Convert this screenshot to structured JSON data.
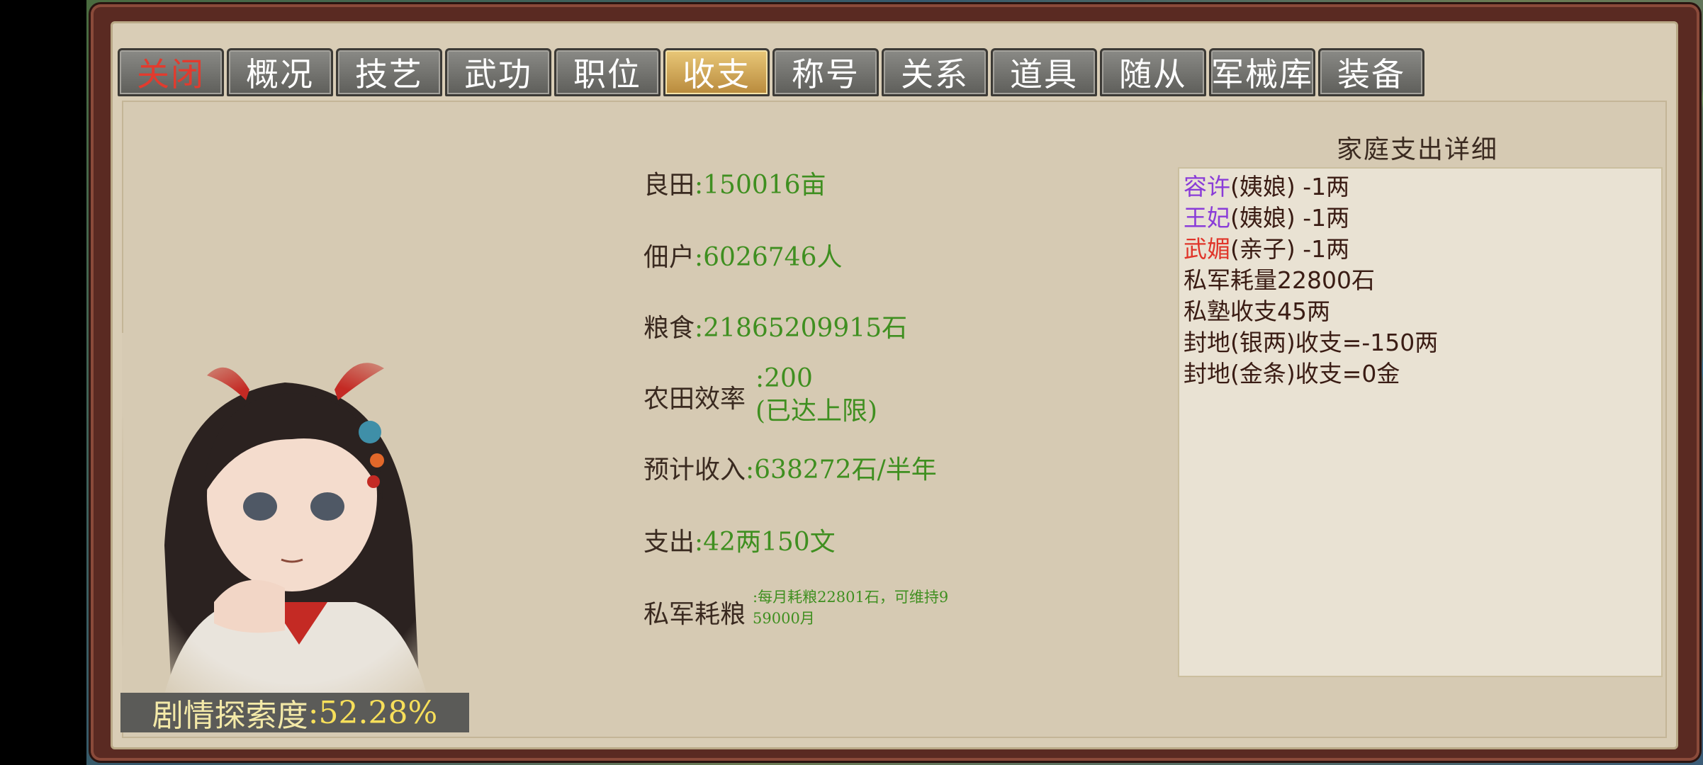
{
  "tabs": [
    "关闭",
    "概况",
    "技艺",
    "武功",
    "职位",
    "收支",
    "称号",
    "关系",
    "道具",
    "随从",
    "军械库",
    "装备"
  ],
  "active_tab": "收支",
  "stats": {
    "field_label": "良田",
    "field_value": ":150016亩",
    "tenant_label": "佃户",
    "tenant_value": ":6026746人",
    "grain_label": "粮食",
    "grain_value": ":21865209915石",
    "efficiency_label": "农田效率",
    "efficiency_value": ":200",
    "efficiency_note": "(已达上限)",
    "income_label": "预计收入",
    "income_value": ":638272石/半年",
    "expense_label": "支出",
    "expense_value": ":42两150文",
    "army_label": "私军耗粮",
    "army_value_line1": ":每月耗粮22801石，可维持9",
    "army_value_line2": "59000月"
  },
  "explore": {
    "label": "剧情探索度",
    "value": ":52.28%"
  },
  "detail": {
    "title": "家庭支出详细",
    "rows": [
      {
        "name": "容许",
        "rest": "(姨娘) -1两"
      },
      {
        "name": "王妃",
        "rest": "(姨娘) -1两"
      },
      {
        "name": "武媚",
        "rest": "(亲子) -1两"
      }
    ],
    "lines": [
      "私军耗量22800石",
      "私塾收支45两",
      "封地(银两)收支=-150两",
      "封地(金条)收支=0金"
    ]
  },
  "colors": {
    "value_green": "#3f8f20",
    "name_purple": "#8a3cd8",
    "name_red": "#e0352a",
    "active_tab_gold": "#d9b25a"
  }
}
